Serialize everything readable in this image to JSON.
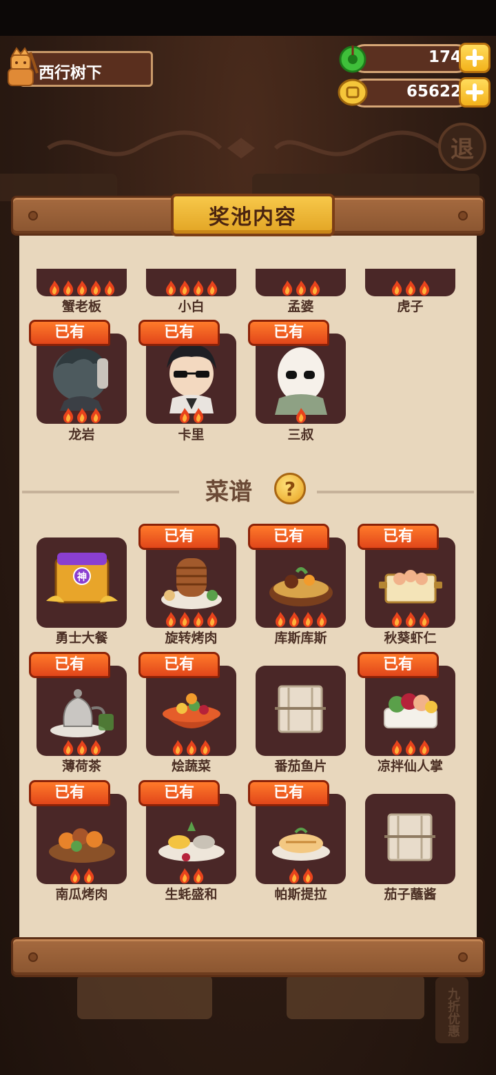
{
  "header": {
    "player_name": "西行树下",
    "jade_count": "174",
    "coin_count": "65622"
  },
  "panel": {
    "title": "奖池内容"
  },
  "characters": [
    {
      "name": "蟹老板",
      "flames": 5,
      "owned": false
    },
    {
      "name": "小白",
      "flames": 4,
      "owned": false
    },
    {
      "name": "孟婆",
      "flames": 3,
      "owned": false
    },
    {
      "name": "虎子",
      "flames": 3,
      "owned": false
    },
    {
      "name": "龙岩",
      "flames": 3,
      "owned": true,
      "tag": "已有"
    },
    {
      "name": "卡里",
      "flames": 2,
      "owned": true,
      "tag": "已有"
    },
    {
      "name": "三叔",
      "flames": 1,
      "owned": true,
      "tag": "已有"
    }
  ],
  "recipes_section": {
    "title": "菜谱",
    "help_icon": "?"
  },
  "recipes": [
    {
      "name": "勇士大餐",
      "flames": 0,
      "owned": false,
      "badge": "神"
    },
    {
      "name": "旋转烤肉",
      "flames": 4,
      "owned": true,
      "tag": "已有"
    },
    {
      "name": "库斯库斯",
      "flames": 4,
      "owned": true,
      "tag": "已有"
    },
    {
      "name": "秋葵虾仁",
      "flames": 3,
      "owned": true,
      "tag": "已有"
    },
    {
      "name": "薄荷茶",
      "flames": 3,
      "owned": true,
      "tag": "已有"
    },
    {
      "name": "烩蔬菜",
      "flames": 3,
      "owned": true,
      "tag": "已有"
    },
    {
      "name": "番茄鱼片",
      "flames": 0,
      "owned": false
    },
    {
      "name": "凉拌仙人掌",
      "flames": 3,
      "owned": true,
      "tag": "已有"
    },
    {
      "name": "南瓜烤肉",
      "flames": 2,
      "owned": true,
      "tag": "已有"
    },
    {
      "name": "生蚝盛和",
      "flames": 2,
      "owned": true,
      "tag": "已有"
    },
    {
      "name": "帕斯提拉",
      "flames": 2,
      "owned": true,
      "tag": "已有"
    },
    {
      "name": "茄子蘸酱",
      "flames": 0,
      "owned": false
    }
  ],
  "background": {
    "exit_glyph": "退",
    "side_badge": "九折优惠"
  }
}
